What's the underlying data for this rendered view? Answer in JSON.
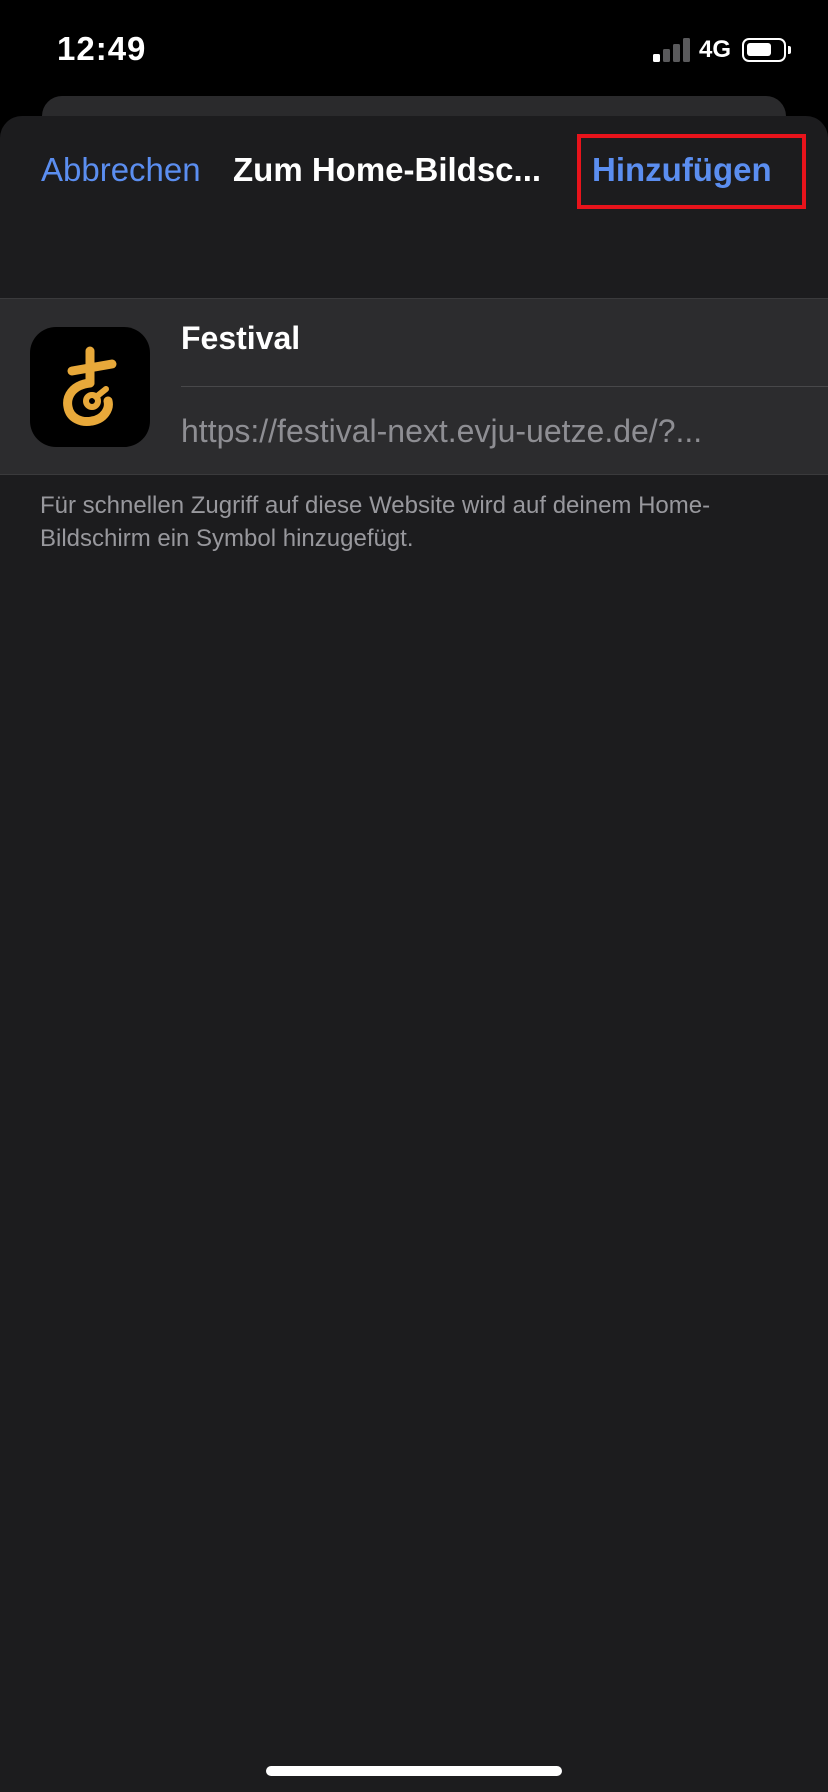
{
  "status_bar": {
    "time": "12:49",
    "network": "4G",
    "signal_bars_active": 1,
    "signal_bars_total": 4,
    "battery_level": 0.7
  },
  "nav": {
    "cancel_label": "Abbrechen",
    "title": "Zum Home-Bildsc...",
    "add_label": "Hinzufügen"
  },
  "form": {
    "icon": "festival-app-icon",
    "name_value": "Festival",
    "url_value": "https://festival-next.evju-uetze.de/?..."
  },
  "hint_text": "Für schnellen Zugriff auf diese Website wird auf deinem Home-Bildschirm ein Symbol hinzugefügt.",
  "colors": {
    "accent": "#5b8ef0",
    "highlight_box": "#e8131b",
    "icon_gold": "#e8a93a",
    "sheet_background": "#1c1c1e"
  }
}
